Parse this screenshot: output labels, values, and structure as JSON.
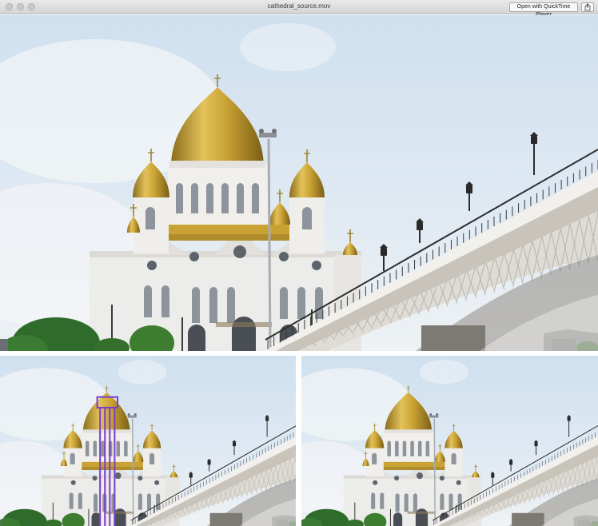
{
  "window": {
    "title": "cathedral_source.mov",
    "open_button_label": "Open with QuickTime Player",
    "share_icon": "share-icon"
  },
  "frames": [
    {
      "name": "main-frame"
    },
    {
      "name": "left-frame",
      "overlay_color": "#7b3fc9"
    },
    {
      "name": "right-frame"
    }
  ],
  "colors": {
    "sky": "#dfe9f2",
    "gold": "#c9a233",
    "stone": "#ececea",
    "bridge": "#d9d6d0",
    "trees": "#2f6b2a"
  }
}
